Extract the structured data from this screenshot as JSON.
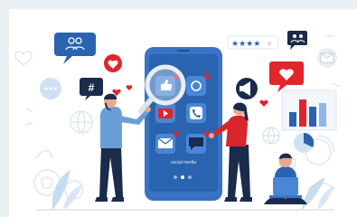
{
  "illustration": {
    "caption": "social media",
    "rating_stars": 5,
    "notification_counts": [
      "1",
      "1",
      "1",
      "1"
    ],
    "hashtag_symbol": "#"
  },
  "colors": {
    "background": "#e9f1f4",
    "card": "#ffffff",
    "primary_blue": "#2a63b0",
    "dark_navy": "#1b2b4b",
    "accent_red": "#e0252c",
    "light_blue": "#cfe1f2"
  }
}
